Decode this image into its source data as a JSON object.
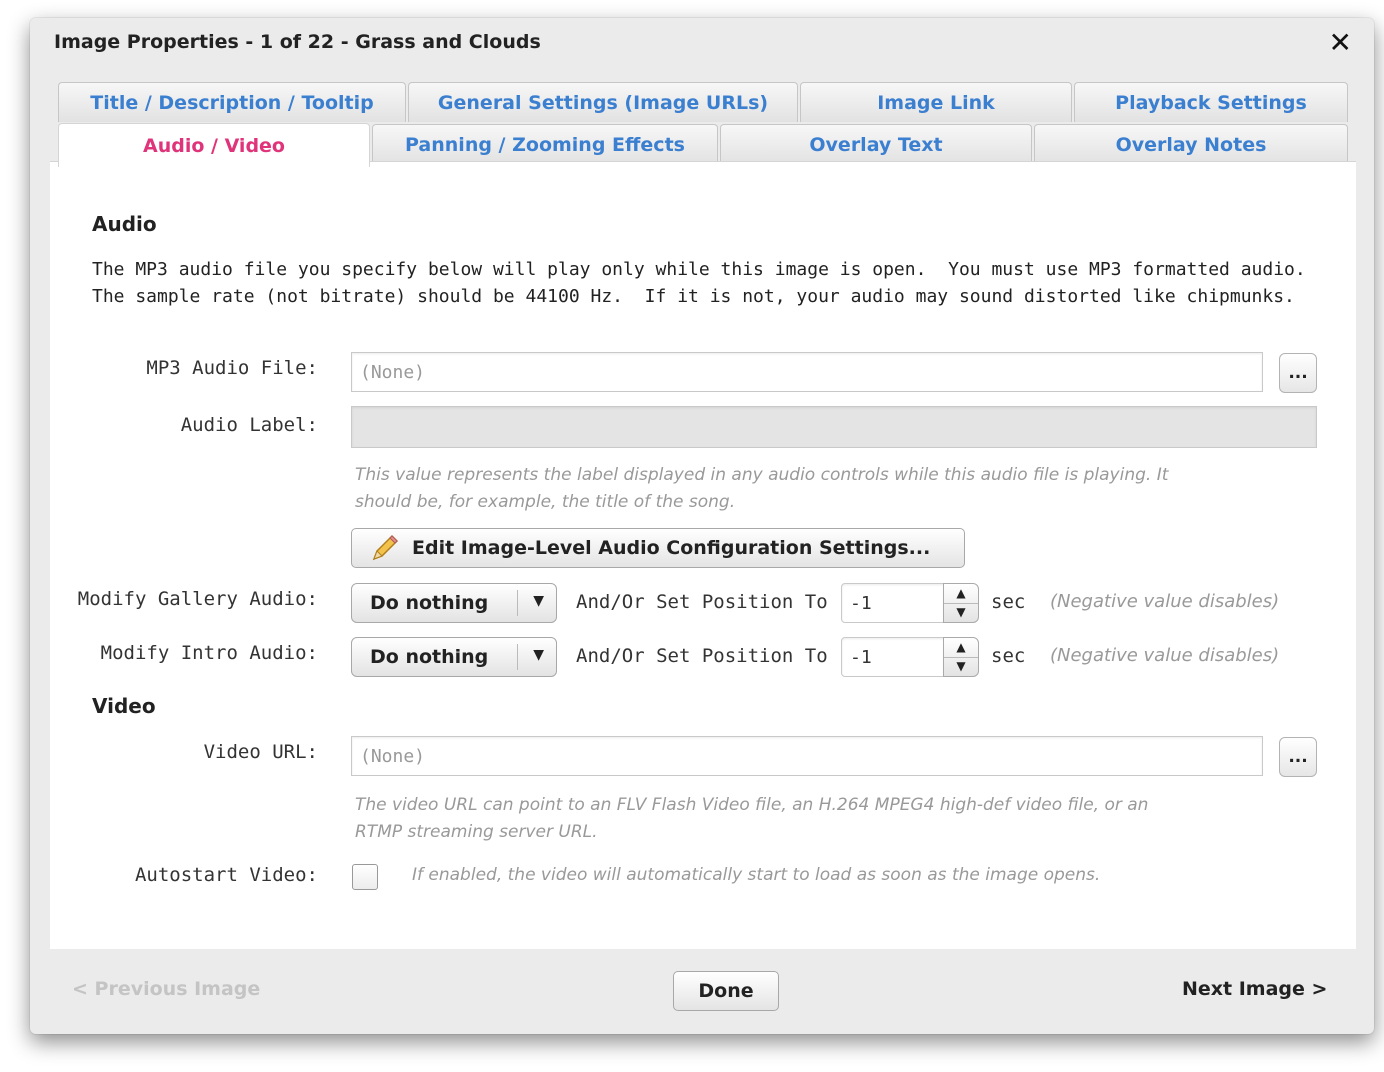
{
  "dialog": {
    "title": "Image Properties - 1 of 22 - Grass and Clouds",
    "close_symbol": "✕"
  },
  "tabs": {
    "row1": [
      "Title / Description / Tooltip",
      "General Settings (Image URLs)",
      "Image Link",
      "Playback Settings"
    ],
    "row2": [
      "Audio / Video",
      "Panning / Zooming Effects",
      "Overlay Text",
      "Overlay Notes"
    ],
    "active": "Audio / Video"
  },
  "audio": {
    "heading": "Audio",
    "description_line1": "The MP3 audio file you specify below will play only while this image is open.  You must use MP3 formatted audio.",
    "description_line2": "The sample rate (not bitrate) should be 44100 Hz.  If it is not, your audio may sound distorted like chipmunks.",
    "mp3_label": "MP3 Audio File:",
    "mp3_placeholder": "(None)",
    "browse_label": "...",
    "audio_label_label": "Audio Label:",
    "audio_label_value": "",
    "audio_label_hint_line1": "This value represents the label displayed in any audio controls while this audio file is playing.  It",
    "audio_label_hint_line2": "should be, for example, the title of the song.",
    "edit_button": "Edit Image-Level Audio Configuration Settings...",
    "gallery_audio": {
      "label": "Modify Gallery Audio:",
      "selected": "Do nothing",
      "position_label": "And/Or Set Position To",
      "position_value": "-1",
      "unit": "sec",
      "note": "(Negative value disables)"
    },
    "intro_audio": {
      "label": "Modify Intro Audio:",
      "selected": "Do nothing",
      "position_label": "And/Or Set Position To",
      "position_value": "-1",
      "unit": "sec",
      "note": "(Negative value disables)"
    }
  },
  "video": {
    "heading": "Video",
    "url_label": "Video URL:",
    "url_placeholder": "(None)",
    "browse_label": "...",
    "url_hint_line1": "The video URL can point to an FLV Flash Video file, an H.264 MPEG4 high-def video file, or an",
    "url_hint_line2": "RTMP streaming server URL.",
    "autostart_label": "Autostart Video:",
    "autostart_checked": false,
    "autostart_hint": "If enabled, the video will automatically start to load as soon as the image opens."
  },
  "footer": {
    "previous": "< Previous Image",
    "done": "Done",
    "next": "Next Image >"
  },
  "colors": {
    "tab_text": "#3b7fd0",
    "active_tab_text": "#e0347a"
  },
  "icons": {
    "edit_button_icon": "pencil-icon",
    "dropdown_icon": "triangle-down-icon",
    "spinner_icon": "up-down-arrows-icon"
  }
}
